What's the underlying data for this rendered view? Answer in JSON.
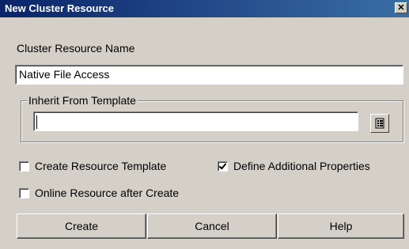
{
  "window": {
    "title": "New Cluster Resource",
    "close_glyph": "✕"
  },
  "form": {
    "resource_name_label": "Cluster Resource Name",
    "resource_name_value": "Native File Access",
    "inherit_group_label": "Inherit From Template",
    "template_value": ""
  },
  "options": {
    "create_template": {
      "label": "Create Resource Template",
      "checked": false
    },
    "define_properties": {
      "label": "Define Additional Properties",
      "checked": true
    },
    "online_after_create": {
      "label": "Online Resource after Create",
      "checked": false
    }
  },
  "buttons": {
    "create": "Create",
    "cancel": "Cancel",
    "help": "Help"
  },
  "icons": {
    "template_browse": "browse-list-icon"
  }
}
